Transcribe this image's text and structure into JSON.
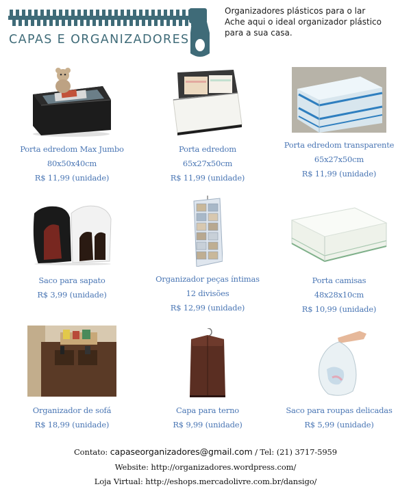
{
  "brand": {
    "name": "CAPAS E ORGANIZADORES",
    "colors": {
      "logo": "#3f6b78",
      "price_text": "#4a76b4"
    }
  },
  "intro": {
    "lines": [
      "Organizadores plásticos para o lar",
      "Ache aqui o ideal organizador plástico",
      "para a sua casa."
    ]
  },
  "products": [
    {
      "name": "Porta edredom Max Jumbo",
      "dims": "80x50x40cm",
      "price": "R$ 11,99 (unidade)"
    },
    {
      "name": "Porta edredom",
      "dims": "65x27x50cm",
      "price": "R$ 11,99 (unidade)"
    },
    {
      "name": "Porta edredom transparente",
      "dims": "65x27x50cm",
      "price": "R$ 11,99 (unidade)"
    },
    {
      "name": "Saco para sapato",
      "dims": "",
      "price": "R$ 3,99 (unidade)"
    },
    {
      "name": "Organizador peças íntimas",
      "dims": "12 divisões",
      "price": "R$ 12,99 (unidade)"
    },
    {
      "name": "Porta camisas",
      "dims": "48x28x10cm",
      "price": "R$ 10,99 (unidade)"
    },
    {
      "name": "Organizador de sofá",
      "dims": "",
      "price": "R$ 18,99 (unidade)"
    },
    {
      "name": "Capa para terno",
      "dims": "",
      "price": "R$ 9,99 (unidade)"
    },
    {
      "name": "Saco para roupas delicadas",
      "dims": "",
      "price": "R$ 5,99 (unidade)"
    }
  ],
  "footer": {
    "contact_label": "Contato:",
    "email": "capaseorganizadores@gmail.com",
    "tel": " / Tel: (21) 3717-5959",
    "website": "Website: http://organizadores.wordpress.com/",
    "store": "Loja Virtual: http://eshops.mercadolivre.com.br/dansigo/"
  }
}
